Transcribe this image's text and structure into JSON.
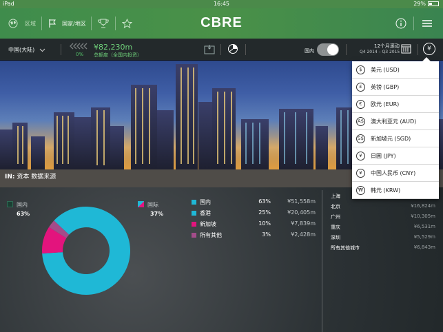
{
  "status_bar": {
    "device": "iPad",
    "time": "16:45",
    "battery": "29%",
    "battery_level": 0.29
  },
  "nav": {
    "region_label": "区域",
    "country_label": "国家/地区",
    "logo": "CBRE"
  },
  "toolbar": {
    "country_select": "中国(大陆)",
    "total_value": "¥82,230m",
    "total_caption": "总额度（全国内投资）",
    "percent_small": "0%",
    "domestic_label": "国内",
    "period_title": "12个月滚动",
    "period_range": "Q4 2014 – Q3 2015",
    "currency_symbol": "¥"
  },
  "info_bar": {
    "prefix": "IN:",
    "text": "资本 数据来源"
  },
  "donut": {
    "domestic_label": "国内",
    "domestic_pct": "63%",
    "intl_label": "国际",
    "intl_pct": "37%",
    "slices": [
      {
        "name": "国内",
        "value": 63,
        "color": "#1fb8d6"
      },
      {
        "name": "新加坡",
        "value": 10,
        "color": "#e3147d"
      },
      {
        "name": "所有其他",
        "value": 3,
        "color": "#a34c8a"
      }
    ],
    "intl_share": 37
  },
  "breakdown": [
    {
      "name": "国内",
      "pct": "63%",
      "value": "¥51,558m",
      "color": "#1fb8d6"
    },
    {
      "name": "香港",
      "pct": "25%",
      "value": "¥20,405m",
      "color": "#1fb8d6"
    },
    {
      "name": "新加坡",
      "pct": "10%",
      "value": "¥7,839m",
      "color": "#e3147d"
    },
    {
      "name": "所有其他",
      "pct": "3%",
      "value": "¥2,428m",
      "color": "#a34c8a"
    }
  ],
  "cities": [
    {
      "name": "上海",
      "value": ""
    },
    {
      "name": "北京",
      "value": "¥16,824m"
    },
    {
      "name": "广州",
      "value": "¥10,305m"
    },
    {
      "name": "重庆",
      "value": "¥6,531m"
    },
    {
      "name": "深圳",
      "value": "¥5,529m"
    },
    {
      "name": "所有其他城市",
      "value": "¥6,843m"
    }
  ],
  "currency_menu": [
    {
      "symbol": "$",
      "label": "美元 (USD)"
    },
    {
      "symbol": "£",
      "label": "英镑 (GBP)"
    },
    {
      "symbol": "€",
      "label": "欧元 (EUR)"
    },
    {
      "symbol": "A$",
      "label": "澳大利亚元 (AUD)"
    },
    {
      "symbol": "S$",
      "label": "新加坡元 (SGD)"
    },
    {
      "symbol": "¥",
      "label": "日圓 (JPY)"
    },
    {
      "symbol": "¥",
      "label": "中国人民币 (CNY)"
    },
    {
      "symbol": "₩",
      "label": "韩元 (KRW)"
    }
  ]
}
